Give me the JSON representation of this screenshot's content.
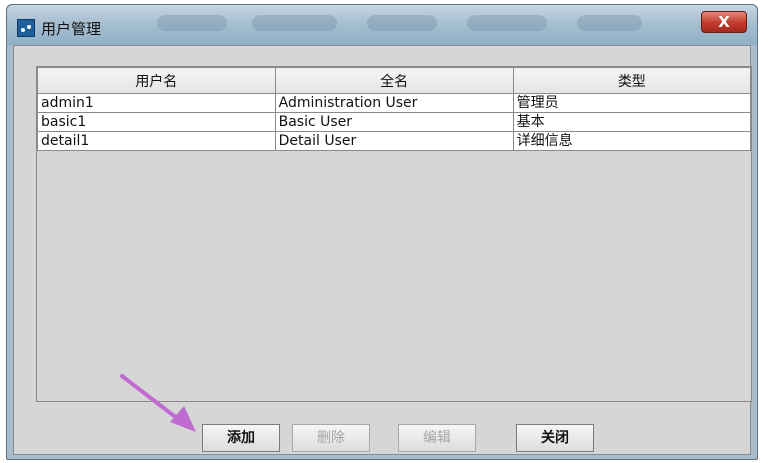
{
  "window": {
    "title": "用户管理",
    "close_label": "X"
  },
  "table": {
    "headers": [
      "用户名",
      "全名",
      "类型"
    ],
    "rows": [
      [
        "admin1",
        "Administration User",
        "管理员"
      ],
      [
        "basic1",
        "Basic User",
        "基本"
      ],
      [
        "detail1",
        "Detail User",
        "详细信息"
      ]
    ]
  },
  "buttons": {
    "add": "添加",
    "delete": "删除",
    "edit": "编辑",
    "close": "关闭"
  },
  "annotation": {
    "arrow_color": "#c06bd0"
  }
}
